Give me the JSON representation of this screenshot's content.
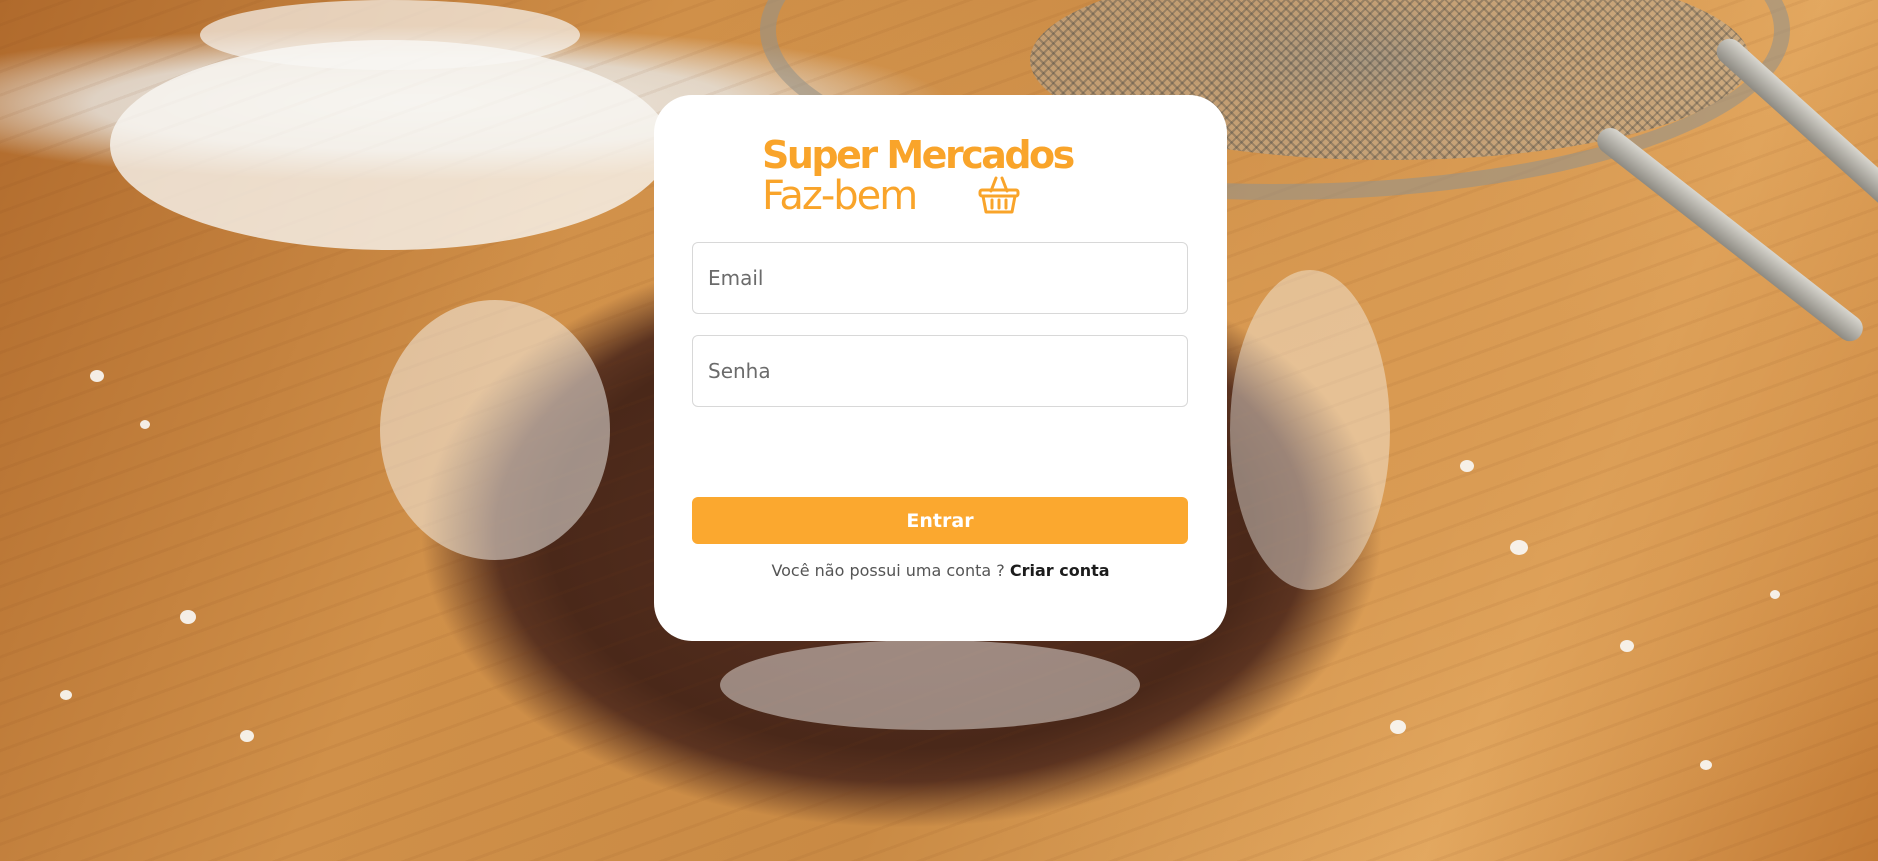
{
  "logo": {
    "line1": "Super Mercados",
    "line2": "Faz-bem",
    "icon": "basket-icon",
    "color": "#f9a42a"
  },
  "form": {
    "email_placeholder": "Email",
    "email_value": "",
    "password_placeholder": "Senha",
    "password_value": "",
    "submit_label": "Entrar",
    "submit_color": "#fba82f"
  },
  "signup": {
    "prompt": "Você não possui uma conta ?",
    "link_label": "Criar conta"
  },
  "background": {
    "description_icon": "cookie-photo-background"
  }
}
